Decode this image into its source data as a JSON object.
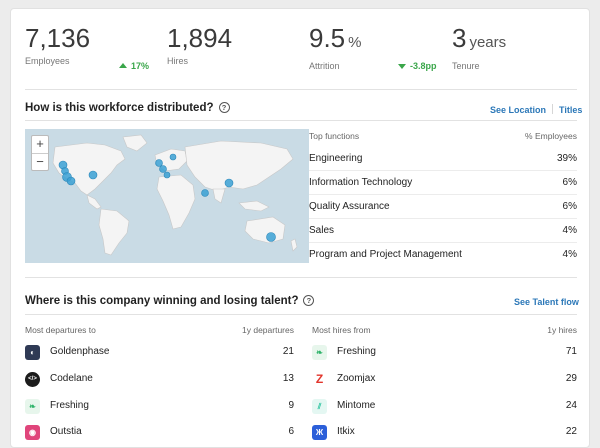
{
  "stats": [
    {
      "value": "7,136",
      "unit": "",
      "label": "Employees",
      "delta": "17%",
      "delta_dir": "up"
    },
    {
      "value": "1,894",
      "unit": "",
      "label": "Hires",
      "delta": "",
      "delta_dir": ""
    },
    {
      "value": "9.5",
      "unit": "%",
      "label": "Attrition",
      "delta": "-3.8pp",
      "delta_dir": "down"
    },
    {
      "value": "3",
      "unit": "years",
      "label": "Tenure",
      "delta": "",
      "delta_dir": ""
    }
  ],
  "distribution": {
    "title": "How is this workforce distributed?",
    "links": [
      "See Location",
      "Titles"
    ],
    "zoom": {
      "in": "+",
      "out": "−"
    },
    "table_header": {
      "function": "Top functions",
      "pct": "% Employees"
    },
    "functions": [
      {
        "name": "Engineering",
        "pct": "39%"
      },
      {
        "name": "Information Technology",
        "pct": "6%"
      },
      {
        "name": "Quality Assurance",
        "pct": "6%"
      },
      {
        "name": "Sales",
        "pct": "4%"
      },
      {
        "name": "Program and Project Management",
        "pct": "4%"
      }
    ]
  },
  "talent": {
    "title": "Where is this company winning and losing talent?",
    "link": "See Talent flow",
    "departures_header": {
      "name": "Most departures to",
      "value": "1y departures"
    },
    "hires_header": {
      "name": "Most hires from",
      "value": "1y hires"
    },
    "departures": [
      {
        "name": "Goldenphase",
        "value": "21",
        "icon": "goldenphase-logo-icon"
      },
      {
        "name": "Codelane",
        "value": "13",
        "icon": "codelane-logo-icon"
      },
      {
        "name": "Freshing",
        "value": "9",
        "icon": "freshing-logo-icon"
      },
      {
        "name": "Outstia",
        "value": "6",
        "icon": "outstia-logo-icon"
      }
    ],
    "hires": [
      {
        "name": "Freshing",
        "value": "71",
        "icon": "freshing-logo-icon"
      },
      {
        "name": "Zoomjax",
        "value": "29",
        "icon": "zoomjax-logo-icon"
      },
      {
        "name": "Mintome",
        "value": "24",
        "icon": "mintome-logo-icon"
      },
      {
        "name": "Itkix",
        "value": "22",
        "icon": "itkix-logo-icon"
      }
    ]
  },
  "colors": {
    "accent": "#2c78b8",
    "positive": "#3aa64a",
    "map_dot": "#3aa0d4"
  }
}
